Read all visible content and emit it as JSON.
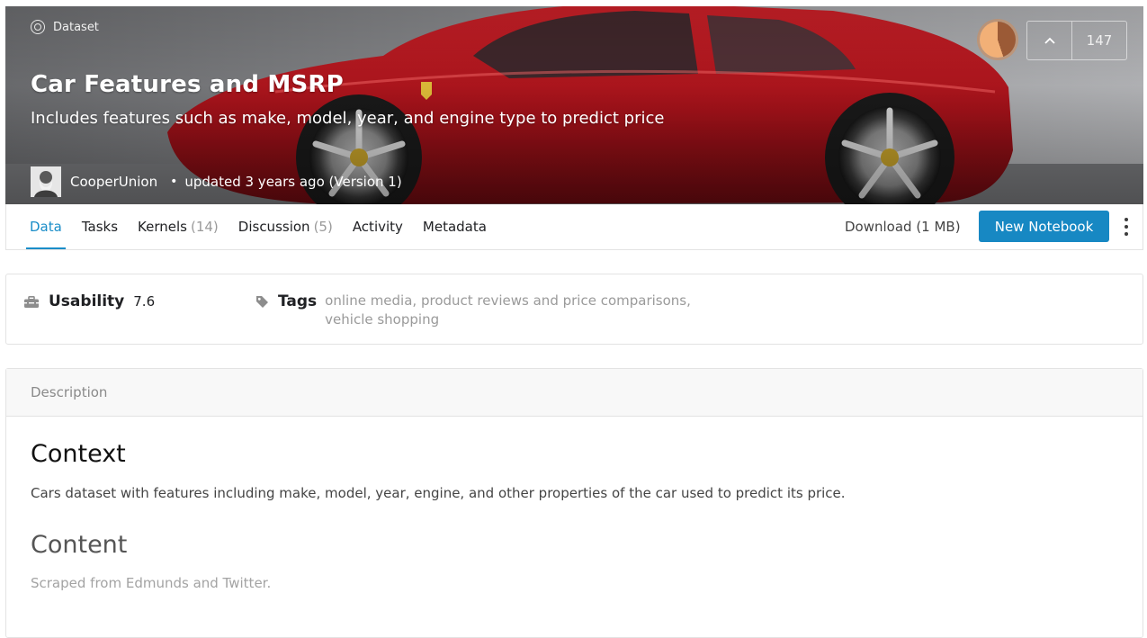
{
  "header": {
    "type_label": "Dataset",
    "title": "Car Features and MSRP",
    "subtitle": "Includes features such as make, model, year, and engine type to predict price",
    "owner": "CooperUnion",
    "updated": "updated 3 years ago (Version 1)",
    "votes": "147"
  },
  "tabs": [
    {
      "label": "Data",
      "count": ""
    },
    {
      "label": "Tasks",
      "count": ""
    },
    {
      "label": "Kernels",
      "count": "(14)"
    },
    {
      "label": "Discussion",
      "count": "(5)"
    },
    {
      "label": "Activity",
      "count": ""
    },
    {
      "label": "Metadata",
      "count": ""
    }
  ],
  "actions": {
    "download_label": "Download (1 MB)",
    "new_notebook_label": "New Notebook"
  },
  "meta": {
    "usability_label": "Usability",
    "usability_value": "7.6",
    "tags_label": "Tags",
    "tags": [
      "online media",
      "product reviews and price comparisons",
      "vehicle shopping"
    ]
  },
  "description": {
    "header": "Description",
    "context_heading": "Context",
    "context_text": "Cars dataset with features including make, model, year, engine, and other properties of the car used to predict its price.",
    "content_heading": "Content",
    "content_text": "Scraped from Edmunds and Twitter."
  },
  "colors": {
    "accent": "#1a8dc8",
    "primary_button": "#1788c3",
    "hero_car": "#b3131b"
  }
}
